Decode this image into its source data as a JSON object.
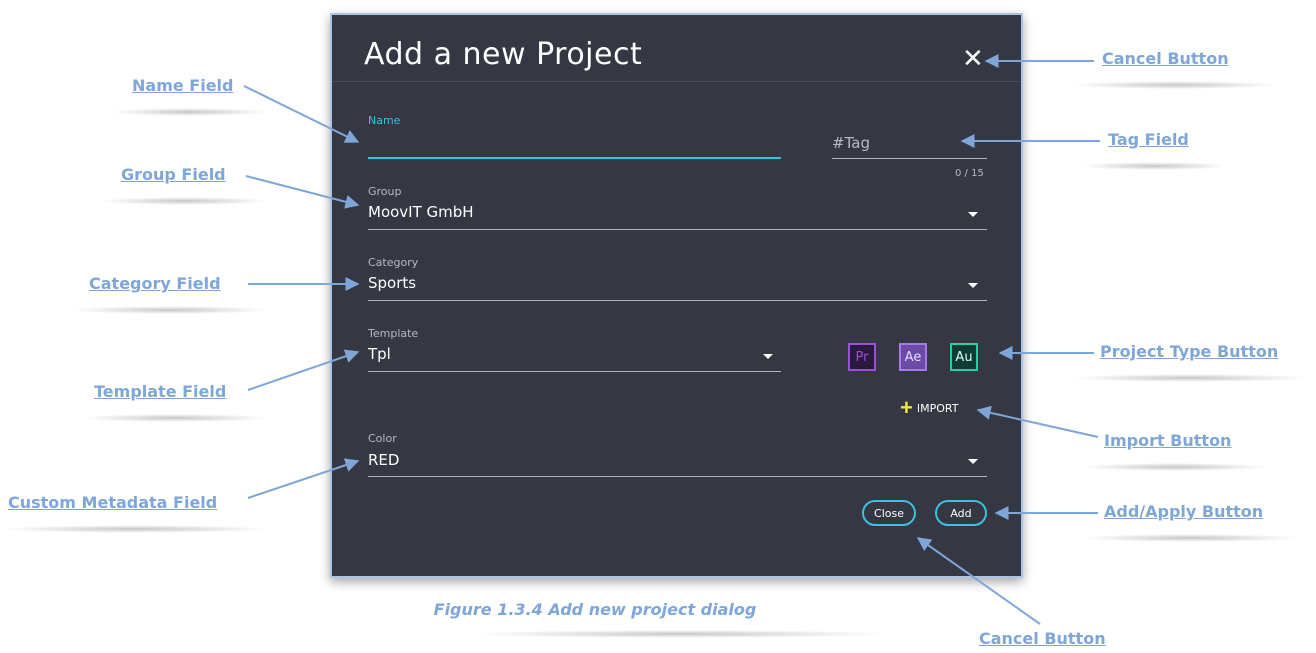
{
  "dialog": {
    "title": "Add a new Project",
    "close_icon": "close-icon",
    "fields": {
      "name": {
        "label": "Name",
        "value": ""
      },
      "tag": {
        "placeholder": "#Tag",
        "counter": "0 / 15"
      },
      "group": {
        "label": "Group",
        "value": "MoovIT GmbH"
      },
      "category": {
        "label": "Category",
        "value": "Sports"
      },
      "template": {
        "label": "Template",
        "value": "Tpl"
      },
      "color": {
        "label": "Color",
        "value": "RED"
      }
    },
    "project_types": [
      {
        "label": "Pr",
        "color": "#9c4fd9",
        "bg": "#2a1a3d"
      },
      {
        "label": "Ae",
        "color": "#a47be8",
        "bg": "#6b4aa8"
      },
      {
        "label": "Au",
        "color": "#1fd2a3",
        "bg": "#0e3b33"
      }
    ],
    "import_label": "IMPORT",
    "close_button": "Close",
    "add_button": "Add"
  },
  "annotations": {
    "name_field": "Name Field",
    "group_field": "Group Field",
    "category_field": "Category Field",
    "template_field": "Template Field",
    "custom_metadata_field": "Custom Metadata Field",
    "cancel_button_top": "Cancel Button",
    "tag_field": "Tag Field",
    "project_type_button": "Project Type Button",
    "import_button": "Import Button",
    "add_apply_button": "Add/Apply Button",
    "cancel_button_bottom": "Cancel Button"
  },
  "caption": "Figure 1.3.4 Add new project dialog",
  "colors": {
    "accent": "#38c2e3",
    "dialog_bg": "#353842",
    "annotation": "#7ea6d8"
  }
}
